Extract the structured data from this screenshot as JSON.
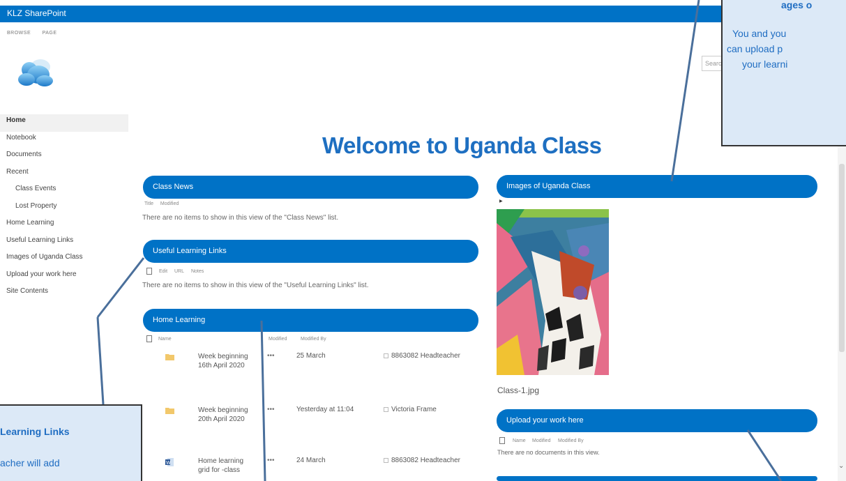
{
  "suite": {
    "brand": "KLZ SharePoint"
  },
  "ribbon": {
    "tabs": [
      "BROWSE",
      "PAGE"
    ]
  },
  "search": {
    "placeholder": "Search"
  },
  "quicklaunch": [
    {
      "label": "Home",
      "active": true
    },
    {
      "label": "Notebook"
    },
    {
      "label": "Documents"
    },
    {
      "label": "Recent"
    },
    {
      "label": "Class Events",
      "sub": true
    },
    {
      "label": "Lost Property",
      "sub": true
    },
    {
      "label": "Home Learning"
    },
    {
      "label": "Useful Learning Links"
    },
    {
      "label": "Images of Uganda Class"
    },
    {
      "label": "Upload your work here"
    },
    {
      "label": "Site Contents"
    }
  ],
  "page": {
    "title": "Welcome to Uganda Class"
  },
  "class_news": {
    "header": "Class News",
    "columns": [
      "Title",
      "Modified"
    ],
    "empty": "There are no items to show in this view of the \"Class News\" list."
  },
  "useful_links": {
    "header": "Useful Learning Links",
    "columns": [
      "Edit",
      "URL",
      "Notes"
    ],
    "empty": "There are no items to show in this view of the \"Useful Learning Links\" list."
  },
  "home_learning": {
    "header": "Home Learning",
    "columns": [
      "Name",
      "Modified",
      "Modified By"
    ],
    "rows": [
      {
        "name": "Week beginning 16th April 2020",
        "modified": "25 March",
        "by": "8863082 Headteacher",
        "icon": "folder-icon"
      },
      {
        "name": "Week beginning 20th April 2020",
        "modified": "Yesterday at 11:04",
        "by": "Victoria Frame",
        "icon": "folder-icon"
      },
      {
        "name": "Home learning grid for -class",
        "modified": "24 March",
        "by": "8863082 Headteacher",
        "icon": "word-doc-icon"
      }
    ]
  },
  "images": {
    "header": "Images of Uganda Class",
    "caption": "Class-1.jpg"
  },
  "upload": {
    "header": "Upload your work here",
    "columns": [
      "Name",
      "Modified",
      "Modified By"
    ],
    "empty": "There are no documents in this view."
  },
  "callout_top": {
    "title": "ages o",
    "lines": [
      "You and you",
      "can upload p",
      "your learni"
    ]
  },
  "callout_bottom": {
    "title": "Learning Links",
    "lines": [
      "acher will add"
    ]
  },
  "colors": {
    "brand_blue": "#0072c6",
    "title_blue": "#1e6fc1",
    "callout_fill": "#dce9f7"
  }
}
